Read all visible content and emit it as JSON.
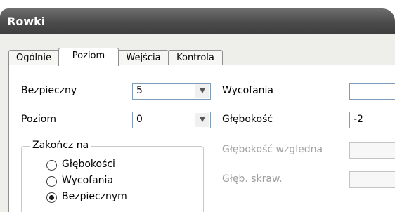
{
  "window": {
    "title": "Rowki"
  },
  "tabs": [
    {
      "label": "Ogólnie",
      "active": false
    },
    {
      "label": "Poziom",
      "active": true
    },
    {
      "label": "Wejścia",
      "active": false
    },
    {
      "label": "Kontrola",
      "active": false
    }
  ],
  "left": {
    "safe": {
      "label": "Bezpieczny",
      "value": "5"
    },
    "level": {
      "label": "Poziom",
      "value": "0"
    },
    "finish_group": {
      "caption": "Zakończ na",
      "options": [
        {
          "label": "Głębokości",
          "selected": false
        },
        {
          "label": "Wycofania",
          "selected": false
        },
        {
          "label": "Bezpiecznym",
          "selected": true
        }
      ]
    }
  },
  "right": {
    "retract": {
      "label": "Wycofania",
      "value": ""
    },
    "depth": {
      "label": "Głębokość",
      "value": "-2"
    },
    "relative_depth": {
      "label": "Głębokość względna",
      "value": "",
      "disabled": true
    },
    "cut_depth": {
      "label": "Głęb. skraw.",
      "value": "",
      "disabled": true
    }
  },
  "icons": {
    "combo_arrow": "chevron-down-icon"
  }
}
